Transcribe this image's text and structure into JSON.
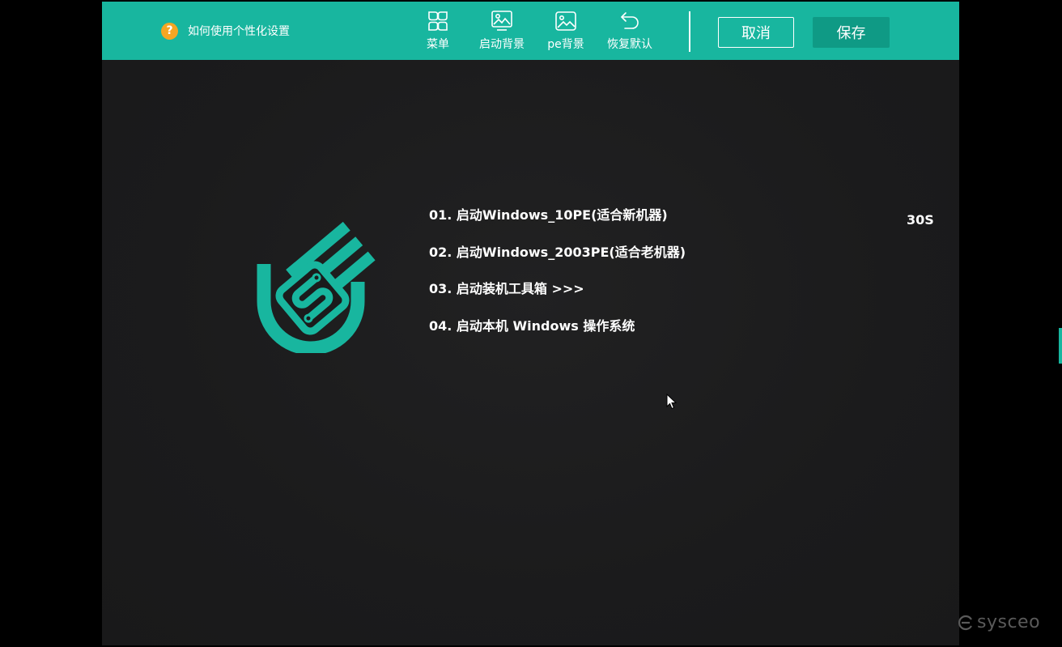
{
  "toolbar": {
    "help_text": "如何使用个性化设置",
    "help_icon_glyph": "?",
    "tools": [
      {
        "label": "菜单",
        "icon": "menu-grid-icon"
      },
      {
        "label": "启动背景",
        "icon": "boot-background-image-icon"
      },
      {
        "label": "pe背景",
        "icon": "pe-background-image-icon"
      },
      {
        "label": "恢复默认",
        "icon": "undo-icon"
      }
    ],
    "cancel_label": "取消",
    "save_label": "保存"
  },
  "preview": {
    "menu_items": [
      "01. 启动Windows_10PE(适合新机器)",
      "02. 启动Windows_2003PE(适合老机器)",
      "03. 启动装机工具箱  >>>",
      "04. 启动本机 Windows 操作系统"
    ],
    "countdown": "30S",
    "logo_icon": "us-shield-logo-icon"
  },
  "watermark": {
    "text": "sysceo"
  },
  "colors": {
    "toolbar": "#18b69f",
    "save_button": "#0f9a85",
    "help_icon": "#f5a623",
    "preview_background": "#1b1b1c",
    "logo": "#18b69f"
  }
}
